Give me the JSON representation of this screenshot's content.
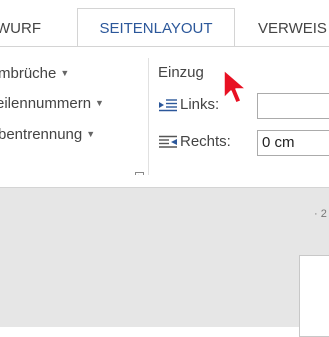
{
  "tabs": [
    {
      "label": "WURF"
    },
    {
      "label": "SEITENLAYOUT"
    },
    {
      "label": "VERWEIS"
    }
  ],
  "ribbon": {
    "commands": [
      {
        "label": "mbrüche"
      },
      {
        "label": "eilennummern"
      },
      {
        "label": "bentrennung"
      }
    ],
    "indent": {
      "group_label": "Einzug",
      "left_label": "Links:",
      "left_value": "",
      "right_label": "Rechts:",
      "right_value": "0 cm"
    }
  },
  "ruler": {
    "text": "· 2"
  },
  "colors": {
    "accent": "#2b579a",
    "cursor": "#e81123"
  }
}
